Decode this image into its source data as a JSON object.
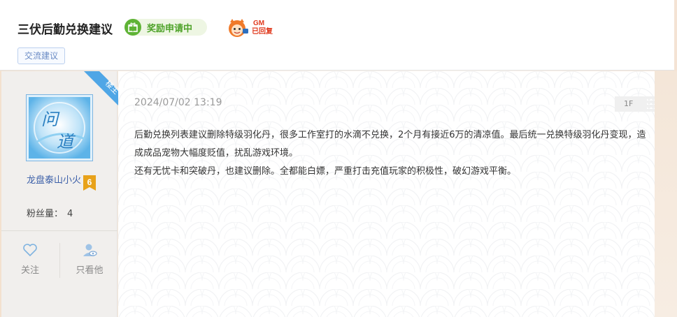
{
  "post": {
    "title": "三伏后勤兑换建议",
    "status_badge": "奖励申请中",
    "gm_badge_top": "GM",
    "gm_badge_bottom": "已回复",
    "tag": "交流建议"
  },
  "author": {
    "role_ribbon": "楼主",
    "avatar_glyphs": "问道",
    "name": "龙盘泰山小火",
    "level": "6",
    "fans_label": "粉丝量：",
    "fans_count": "4",
    "follow_label": "关注",
    "only_view_label": "只看他"
  },
  "content": {
    "timestamp": "2024/07/02 13:19",
    "floor": "1F",
    "paragraphs": [
      "后勤兑换列表建议删除特级羽化丹，很多工作室打的水滴不兑换，2个月有接近6万的清凉值。最后统一兑换特级羽化丹变现，造成成品宠物大幅度贬值，扰乱游戏环境。",
      "还有无忧卡和突破丹，也建议删除。全都能白嫖，严重打击充值玩家的积极性，破幻游戏平衡。"
    ]
  },
  "colors": {
    "accent_green": "#5fb336",
    "link_blue": "#3b5fa8",
    "ribbon_blue": "#4fa6e6",
    "level_gold": "#e8a21a"
  },
  "icons": [
    "gift-icon",
    "gm-mascot-icon",
    "heart-icon",
    "user-eye-icon"
  ]
}
